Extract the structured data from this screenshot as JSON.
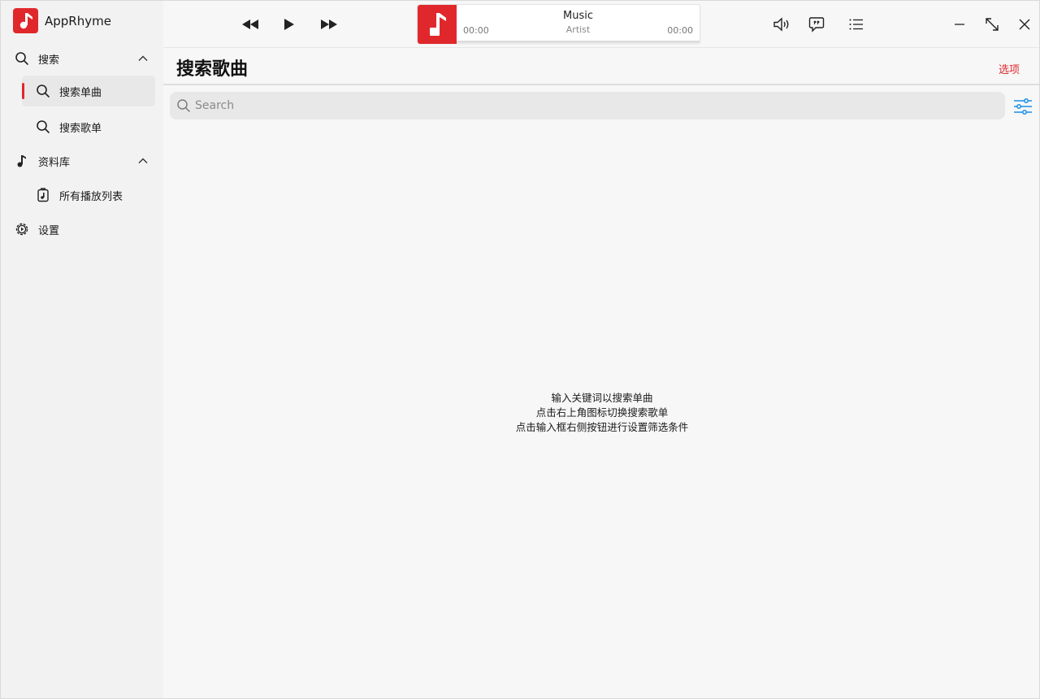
{
  "app": {
    "name": "AppRhyme"
  },
  "sidebar": {
    "search_group": {
      "label": "搜索"
    },
    "search_songs": {
      "label": "搜索单曲"
    },
    "search_playlists": {
      "label": "搜索歌单"
    },
    "library_group": {
      "label": "资料库"
    },
    "all_playlists": {
      "label": "所有播放列表"
    },
    "settings": {
      "label": "设置"
    }
  },
  "player": {
    "title": "Music",
    "artist": "Artist",
    "time_elapsed": "00:00",
    "time_total": "00:00",
    "progress": 0
  },
  "main": {
    "title": "搜索歌曲",
    "options_label": "选项",
    "search": {
      "placeholder": "Search",
      "value": ""
    },
    "hints": [
      "输入关键词以搜索单曲",
      "点击右上角图标切换搜索歌单",
      "点击输入框右侧按钮进行设置筛选条件"
    ]
  },
  "colors": {
    "accent": "#e0282c",
    "filter_icon": "#1a8ee8"
  }
}
